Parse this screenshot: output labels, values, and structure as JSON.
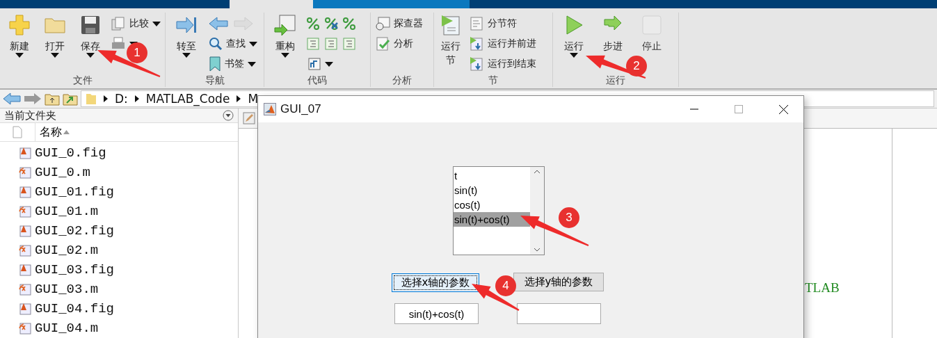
{
  "ribbon": {
    "sections": [
      {
        "title": "文件",
        "items": [
          {
            "kind": "big",
            "label": "新建",
            "caret": true
          },
          {
            "kind": "big",
            "label": "打开",
            "caret": true
          },
          {
            "kind": "big",
            "label": "保存",
            "caret": true
          },
          {
            "kind": "stack",
            "rows": [
              {
                "label": "比较",
                "caret": true
              },
              {
                "caret": true
              }
            ]
          }
        ]
      },
      {
        "title": "导航",
        "items": [
          {
            "kind": "big",
            "label": "转至",
            "caret": true
          },
          {
            "kind": "stack",
            "rows": [
              {
                "caret": false
              },
              {
                "label": "查找",
                "caret": true
              },
              {
                "label": "书签",
                "caret": true
              }
            ]
          }
        ]
      },
      {
        "title": "代码",
        "items": [
          {
            "kind": "big",
            "label": "重构",
            "caret": true
          },
          {
            "kind": "grid",
            "caret": true
          }
        ]
      },
      {
        "title": "分析",
        "items": [
          {
            "kind": "stack",
            "rows": [
              {
                "label": "探查器",
                "caret": false
              },
              {
                "label": "分析",
                "caret": false
              }
            ]
          }
        ]
      },
      {
        "title": "节",
        "items": [
          {
            "kind": "big",
            "label": "运行节",
            "caret": false
          },
          {
            "kind": "stack",
            "rows": [
              {
                "label": "分节符",
                "caret": false
              },
              {
                "label": "运行并前进",
                "caret": false
              },
              {
                "label": "运行到结束",
                "caret": false
              }
            ]
          }
        ]
      },
      {
        "title": "运行",
        "items": [
          {
            "kind": "big",
            "label": "运行",
            "caret": true
          },
          {
            "kind": "big",
            "label": "步进",
            "caret": false
          },
          {
            "kind": "big",
            "label": "停止",
            "caret": false,
            "disabled": true
          }
        ]
      }
    ]
  },
  "address_bar": {
    "path": [
      "D:",
      "MATLAB_Code",
      "M"
    ]
  },
  "current_folder": {
    "title": "当前文件夹",
    "column": "名称",
    "files": [
      {
        "name": "GUI_0.fig",
        "kind": "fig"
      },
      {
        "name": "GUI_0.m",
        "kind": "m"
      },
      {
        "name": "GUI_01.fig",
        "kind": "fig"
      },
      {
        "name": "GUI_01.m",
        "kind": "m"
      },
      {
        "name": "GUI_02.fig",
        "kind": "fig"
      },
      {
        "name": "GUI_02.m",
        "kind": "m"
      },
      {
        "name": "GUI_03.fig",
        "kind": "fig"
      },
      {
        "name": "GUI_03.m",
        "kind": "m"
      },
      {
        "name": "GUI_04.fig",
        "kind": "fig"
      },
      {
        "name": "GUI_04.m",
        "kind": "m"
      }
    ]
  },
  "editor": {
    "lines": [
      {
        "text": "TLAB"
      }
    ]
  },
  "dialog": {
    "title": "GUI_07",
    "listbox": [
      {
        "label": "t",
        "selected": false
      },
      {
        "label": "sin(t)",
        "selected": false
      },
      {
        "label": "cos(t)",
        "selected": false
      },
      {
        "label": "sin(t)+cos(t)",
        "selected": true
      }
    ],
    "buttons": [
      {
        "label": "选择x轴的参数",
        "focused": true
      },
      {
        "label": "选择y轴的参数",
        "focused": false
      }
    ],
    "fields": [
      {
        "kind": "filled",
        "value": "sin(t)+cos(t)"
      },
      {
        "kind": "blank"
      }
    ]
  },
  "annotations": [
    {
      "label": "1"
    },
    {
      "label": "2"
    },
    {
      "label": "3"
    },
    {
      "label": "4"
    }
  ]
}
